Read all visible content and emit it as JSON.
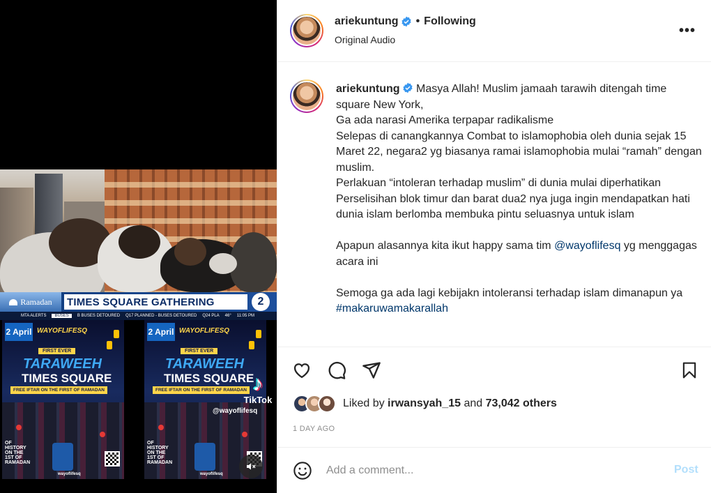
{
  "post": {
    "username": "ariekuntung",
    "dot": "•",
    "follow_status": "Following",
    "audio": "Original Audio",
    "more": "•••"
  },
  "media": {
    "lower_third_tag": "Ramadan",
    "lower_third_title": "TIMES SQUARE GATHERING",
    "network_logo": "2",
    "ticker": [
      "MTA ALERTS",
      "BUSES",
      "B BUSES DETOURED",
      "Q17 PLANNED - BUSES DETOURED",
      "Q24 PLA",
      "46°",
      "11:05 PM"
    ],
    "poster": {
      "date": "2 April",
      "brand": "WAYOFLIFESQ",
      "first_ever": "FIRST EVER",
      "title_1": "TARAWEEH",
      "title_2": "TIMES SQUARE",
      "iftar": "FREE IFTAR ON THE FIRST OF RAMADAN",
      "history": "OF HISTORY ON THE 1ST OF RAMADAN",
      "handle": "wayoflifesq"
    },
    "tiktok_word": "TikTok",
    "tiktok_handle": "@wayoflifesq"
  },
  "caption": {
    "line_1": "Masya Allah! Muslim jamaah tarawih ditengah time square New York,\nGa ada narasi Amerika terpapar radikalisme\nSelepas di canangkannya Combat to islamophobia oleh dunia sejak 15 Maret 22, negara2 yg biasanya ramai islamophobia mulai “ramah” dengan muslim.\nPerlakuan “intoleran terhadap muslim” di dunia mulai diperhatikan\nPerselisihan blok timur dan barat dua2 nya juga ingin mendapatkan hati dunia islam berlomba membuka pintu seluasnya untuk islam",
    "para_2_before": "Apapun alasannya kita ikut happy sama tim ",
    "mention": "@wayoflifesq",
    "para_2_after": " yg menggagas acara ini",
    "para_3": "Semoga ga ada lagi kebijakn intoleransi terhadap islam dimanapun ya",
    "hashtag": "#makaruwamakarallah"
  },
  "likes": {
    "prefix": "Liked by ",
    "user": "irwansyah_15",
    "middle": " and ",
    "count": "73,042 others"
  },
  "timestamp": "1 DAY AGO",
  "comment": {
    "placeholder": "Add a comment...",
    "post_label": "Post"
  },
  "colors": {
    "verified": "#3897f0",
    "link": "#00376b",
    "post_disabled": "#b2dffc"
  }
}
